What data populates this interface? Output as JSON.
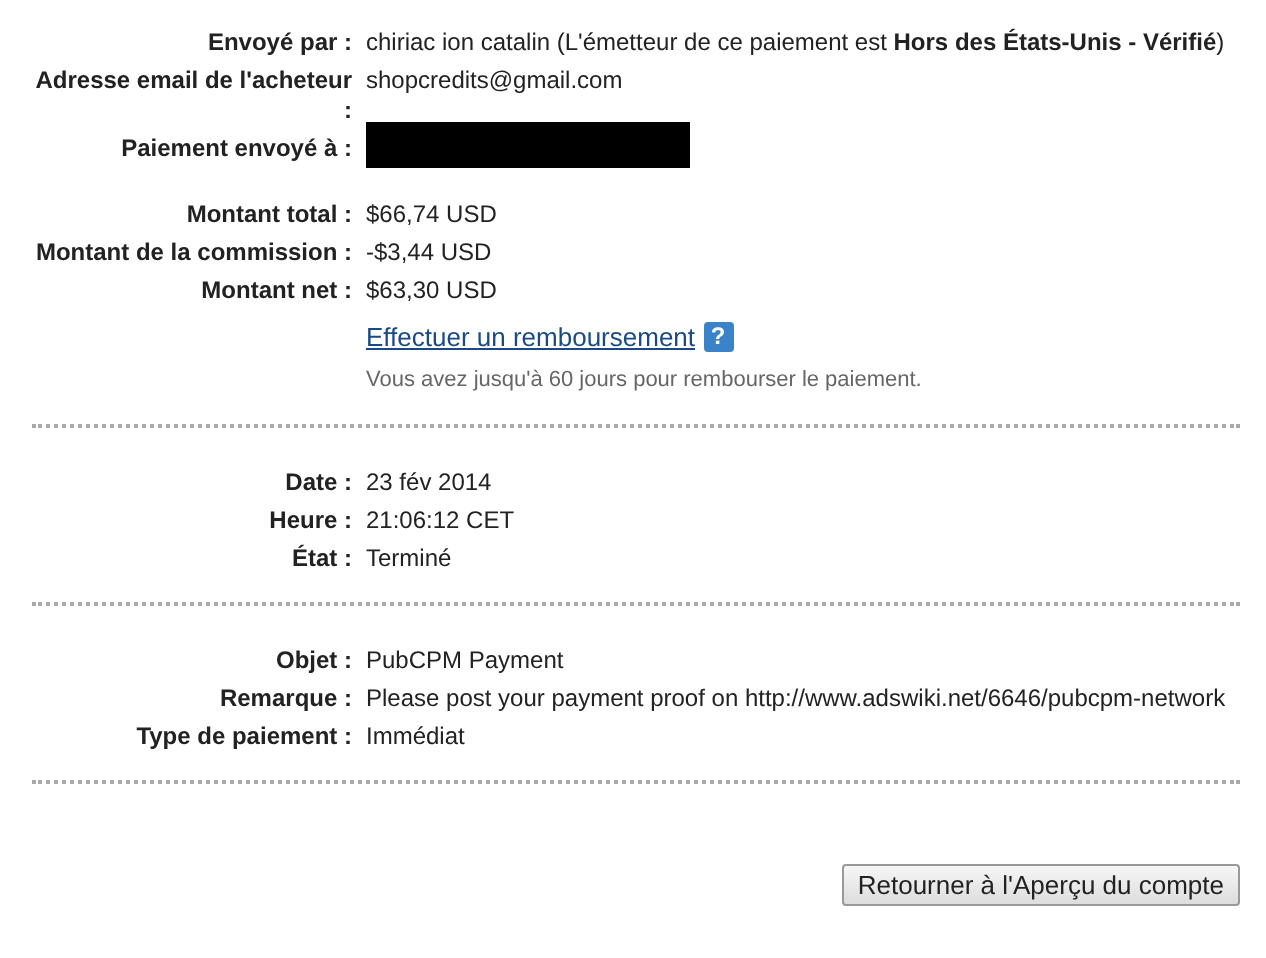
{
  "sections": [
    {
      "rows": [
        {
          "kind": "field",
          "label": "Envoyé par :",
          "value": "chiriac ion catalin (L'émetteur de ce paiement est **Hors des États-Unis - Vérifié**)"
        },
        {
          "kind": "field",
          "label": "Adresse email de l'acheteur :",
          "value": "shopcredits@gmail.com"
        },
        {
          "kind": "redacted",
          "label": "Paiement envoyé à :"
        },
        {
          "kind": "field",
          "label": "Montant total :",
          "value": "$66,74 USD"
        },
        {
          "kind": "field",
          "label": "Montant de la commission :",
          "value": "-$3,44 USD"
        },
        {
          "kind": "field",
          "label": "Montant net :",
          "value": "$63,30 USD"
        },
        {
          "kind": "link",
          "value": "Effectuer un remboursement",
          "help": "?"
        },
        {
          "kind": "note",
          "value": "Vous avez jusqu'à 60 jours pour rembourser le paiement."
        }
      ]
    },
    {
      "rows": [
        {
          "kind": "field",
          "label": "Date :",
          "value": "23 fév 2014"
        },
        {
          "kind": "field",
          "label": "Heure :",
          "value": "21:06:12 CET"
        },
        {
          "kind": "field",
          "label": "État :",
          "value": "Terminé"
        }
      ]
    },
    {
      "rows": [
        {
          "kind": "field",
          "label": "Objet :",
          "value": "PubCPM Payment"
        },
        {
          "kind": "field",
          "label": "Remarque :",
          "value": "Please post your payment proof on http://www.adswiki.net/6646/pubcpm-network"
        },
        {
          "kind": "field",
          "label": "Type de paiement :",
          "value": "Immédiat"
        }
      ]
    }
  ],
  "button": "Retourner à l'Aperçu du compte"
}
